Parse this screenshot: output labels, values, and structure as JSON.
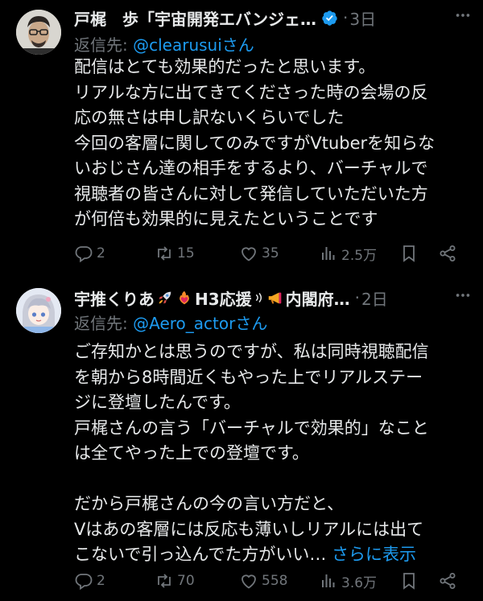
{
  "tweets": [
    {
      "author_name": "戸梶　歩「宇宙開発エバンジェ…",
      "verified": true,
      "separator": "·",
      "time": "3日",
      "reply_label": "返信先: ",
      "reply_handle": "@clearusui",
      "reply_suffix": "さん",
      "body_lines": [
        "配信はとても効果的だったと思います。",
        "リアルな方に出てきてくださった時の会場の反",
        "応の無さは申し訳ないくらいでした",
        "今回の客層に関してのみですがVtuberを知らな",
        "いおじさん達の相手をするより、バーチャルで",
        "視聴者の皆さんに対して発信していただいた方",
        "が何倍も効果的に見えたということです"
      ],
      "actions": {
        "replies": "2",
        "reposts": "15",
        "likes": "35",
        "views": "2.5万"
      }
    },
    {
      "author_name": "宇推くりあ",
      "emoji_1": "rocket-emoji",
      "emoji_2": "fire-heart-emoji",
      "author_name_2": "H3応援",
      "author_name_3": "内閣府…",
      "emoji_3": "megaphone-emoji",
      "separator": "·",
      "time": "2日",
      "reply_label": "返信先: ",
      "reply_handle": "@Aero_actor",
      "reply_suffix": "さん",
      "body_lines": [
        "ご存知かとは思うのですが、私は同時視聴配信",
        "を朝から8時間近くもやった上でリアルステー",
        "ジに登壇したんです。",
        "戸梶さんの言う「バーチャルで効果的」なこと",
        "は全てやった上での登壇です。",
        "",
        "だから戸梶さんの今の言い方だと、",
        "Vはあの客層には反応も薄いしリアルには出て",
        "こないで引っ込んでた方がいい…"
      ],
      "show_more": "さらに表示",
      "actions": {
        "replies": "2",
        "reposts": "70",
        "likes": "558",
        "views": "3.6万"
      }
    }
  ],
  "colors": {
    "background": "#000000",
    "text": "#e7e9ea",
    "muted": "#71767b",
    "accent": "#1d9bf0"
  }
}
